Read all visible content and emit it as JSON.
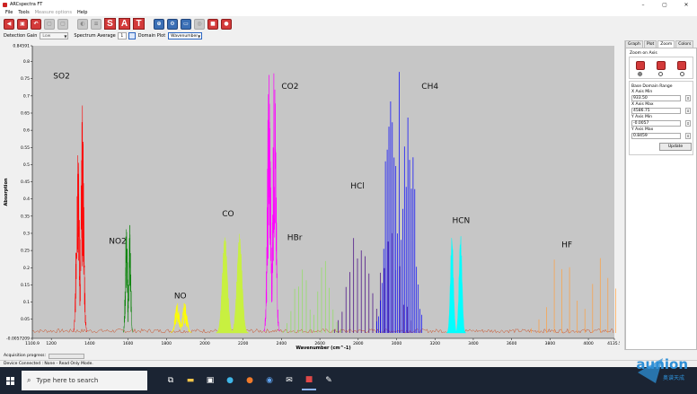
{
  "window": {
    "title": "ARCspectra FT",
    "minimize": "–",
    "maximize": "▢",
    "close": "✕"
  },
  "menu": {
    "items": [
      {
        "label": "File",
        "enabled": true
      },
      {
        "label": "Tools",
        "enabled": true
      },
      {
        "label": "Measure options",
        "enabled": false
      },
      {
        "label": "Help",
        "enabled": true
      }
    ]
  },
  "toolbar": {
    "letter_buttons": [
      "S",
      "A",
      "T"
    ]
  },
  "options": {
    "detection_gain_label": "Detection Gain",
    "detection_gain_value": "Low",
    "spectrum_average_label": "Spectrum Average",
    "spectrum_average_value": "1",
    "domain_plot_label": "Domain Plot",
    "domain_plot_value": "Wavenumber"
  },
  "right_panel": {
    "tabs": [
      "Graph",
      "Plot",
      "Zoom",
      "Colors"
    ],
    "active_tab": "Zoom",
    "zoom_on_axis_label": "Zoom on Axis",
    "base_domain_range_label": "Base Domain Range",
    "fields": [
      {
        "label": "X Axis Min",
        "value": "933.50"
      },
      {
        "label": "X Axis Max",
        "value": "4586.75"
      },
      {
        "label": "Y Axis Min",
        "value": "-0.0057"
      },
      {
        "label": "Y Axis Max",
        "value": "0.8459"
      }
    ],
    "update_label": "Update"
  },
  "status": {
    "acquisition_label": "Acquisition progress:",
    "device_status": "Device Connected : None - Read Only Mode."
  },
  "taskbar": {
    "search_placeholder": "Type here to search"
  },
  "watermark": {
    "brand": "aunion",
    "sub": "奥谱天成"
  },
  "colors": {
    "plot_bg": "#c6c6c6",
    "SO2": "#ff0000",
    "NO2": "#008000",
    "NO": "#ffff00",
    "CO": "#c8f040",
    "CO2": "#ff00ff",
    "HBr": "#90e060",
    "HCl": "#400080",
    "CH4": "#0000ff",
    "HCN": "#00ffff",
    "HF": "#ffa040"
  },
  "chart_data": {
    "type": "line",
    "title": "",
    "xlabel": "Wavenumber (cm^-1)",
    "ylabel": "Absorption",
    "xlim": [
      1100.9,
      4135.5
    ],
    "ylim": [
      -0.0057,
      0.84591
    ],
    "x_ticks": [
      1100.9,
      1200,
      1400,
      1600,
      1800,
      2000,
      2200,
      2400,
      2600,
      2800,
      3000,
      3200,
      3400,
      3600,
      3800,
      4000,
      4135.5
    ],
    "y_ticks": [
      -0.0057,
      0.05,
      0.1,
      0.15,
      0.2,
      0.25,
      0.3,
      0.35,
      0.4,
      0.45,
      0.5,
      0.55,
      0.6,
      0.65,
      0.7,
      0.75,
      0.8,
      0.84591
    ],
    "y_tick_labels": [
      "-0.0057209",
      "0.05",
      "0.1",
      "0.15",
      "0.2",
      "0.25",
      "0.3",
      "0.35",
      "0.4",
      "0.45",
      "0.5",
      "0.55",
      "0.6",
      "0.65",
      "0.7",
      "0.75",
      "0.8",
      "0.84591"
    ],
    "x_tick_labels": [
      "1100.9",
      "1200",
      "1400",
      "1600",
      "1800",
      "2000",
      "2200",
      "2400",
      "2600",
      "2800",
      "3000",
      "3200",
      "3400",
      "3600",
      "3800",
      "4000",
      "4135.5"
    ],
    "grid": false,
    "annotations": [
      {
        "text": "SO2",
        "x": 1210,
        "y": 0.75
      },
      {
        "text": "NO2",
        "x": 1500,
        "y": 0.27
      },
      {
        "text": "NO",
        "x": 1840,
        "y": 0.11
      },
      {
        "text": "CO",
        "x": 2090,
        "y": 0.35
      },
      {
        "text": "CO2",
        "x": 2400,
        "y": 0.72
      },
      {
        "text": "HBr",
        "x": 2430,
        "y": 0.28
      },
      {
        "text": "HCl",
        "x": 2760,
        "y": 0.43
      },
      {
        "text": "CH4",
        "x": 3130,
        "y": 0.72
      },
      {
        "text": "HCN",
        "x": 3290,
        "y": 0.33
      },
      {
        "text": "HF",
        "x": 3860,
        "y": 0.26
      }
    ],
    "series": [
      {
        "name": "SO2",
        "band_center": 1350,
        "band_width": 35,
        "peak": 0.67,
        "style": "dense"
      },
      {
        "name": "NO2",
        "band_center": 1600,
        "band_width": 25,
        "peak": 0.35,
        "style": "dense"
      },
      {
        "name": "NO",
        "band_center": 1876,
        "band_width": 55,
        "peak": 0.09,
        "style": "dense"
      },
      {
        "name": "CO",
        "band_center": 2143,
        "band_width": 85,
        "peak": 0.29,
        "style": "fill"
      },
      {
        "name": "CO2",
        "band_center": 2349,
        "band_width": 40,
        "peak": 0.82,
        "style": "dense"
      },
      {
        "name": "HBr",
        "band_center": 2559,
        "band_width": 150,
        "peak": 0.22,
        "style": "lines"
      },
      {
        "name": "HCl",
        "band_center": 2886,
        "band_width": 210,
        "peak": 0.33,
        "style": "lines"
      },
      {
        "name": "CH4",
        "band_center": 3017,
        "band_width": 120,
        "peak": 0.76,
        "style": "lines"
      },
      {
        "name": "HCN",
        "band_center": 3311,
        "band_width": 50,
        "peak": 0.29,
        "style": "fill"
      },
      {
        "name": "HF",
        "band_center": 3962,
        "band_width": 260,
        "peak": 0.27,
        "style": "lines"
      }
    ]
  }
}
